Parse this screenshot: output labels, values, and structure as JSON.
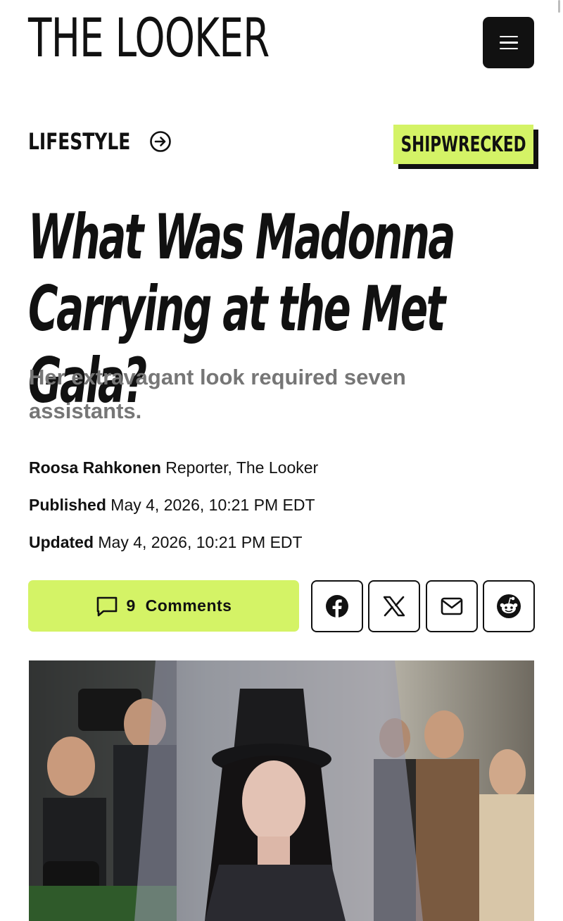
{
  "site": {
    "logo_text": "THE LOOKER"
  },
  "header": {
    "menu_icon": "hamburger-menu-icon"
  },
  "category": {
    "label": "LIFESTYLE",
    "icon": "arrow-right-circle-icon"
  },
  "tag": {
    "label": "SHIPWRECKED",
    "color": "#d4f366"
  },
  "article": {
    "headline": "What Was Madonna Carrying at the Met Gala?",
    "subheadline": "Her extravagant look required seven assistants.",
    "author": {
      "name": "Roosa Rahkonen",
      "role": "Reporter, The Looker"
    },
    "published": {
      "label": "Published",
      "value": "May 4, 2026, 10:21 PM EDT"
    },
    "updated": {
      "label": "Updated",
      "value": "May 4, 2026, 10:21 PM EDT"
    }
  },
  "actions": {
    "comments": {
      "count": "9",
      "label": "Comments",
      "icon": "comment-bubble-icon"
    },
    "share": [
      {
        "name": "facebook",
        "icon": "facebook-icon"
      },
      {
        "name": "x",
        "icon": "x-icon"
      },
      {
        "name": "email",
        "icon": "mail-icon"
      },
      {
        "name": "reddit",
        "icon": "reddit-icon"
      }
    ]
  },
  "colors": {
    "accent": "#d4f366",
    "text": "#111111",
    "muted": "#767676"
  }
}
